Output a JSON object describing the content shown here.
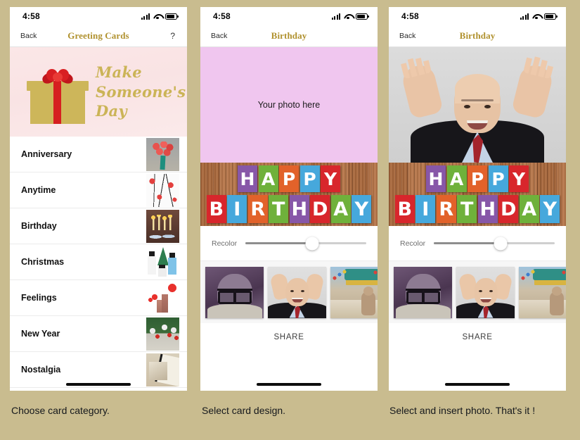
{
  "app": {
    "background_color": "#c9bc8f"
  },
  "status_bar": {
    "time": "4:58",
    "icons": [
      "signal-icon",
      "wifi-icon",
      "battery-icon"
    ]
  },
  "phones": [
    {
      "id": "phone-category-list",
      "nav": {
        "back": "Back",
        "title": "Greeting Cards",
        "help": "?"
      },
      "hero": {
        "headline": "Make\nSomeone's\nDay",
        "background_color": "#fbe7e7",
        "accent_color": "#cbb457",
        "icon": "gift-box-icon"
      },
      "categories": [
        {
          "label": "Anniversary",
          "thumb": "roses-thumbnail"
        },
        {
          "label": "Anytime",
          "thumb": "floral-thumbnail"
        },
        {
          "label": "Birthday",
          "thumb": "candles-thumbnail"
        },
        {
          "label": "Christmas",
          "thumb": "snowmen-thumbnail"
        },
        {
          "label": "Feelings",
          "thumb": "hearts-thumbnail"
        },
        {
          "label": "New Year",
          "thumb": "wreath-thumbnail"
        },
        {
          "label": "Nostalgia",
          "thumb": "old-photos-thumbnail"
        }
      ]
    },
    {
      "id": "phone-card-design",
      "nav": {
        "back": "Back",
        "title": "Birthday",
        "help": ""
      },
      "photo": {
        "placeholder": "Your photo here",
        "filled": false,
        "background_color": "#f0c6ef"
      },
      "slider": {
        "label": "Recolor",
        "value": 55
      },
      "photo_strip": [
        {
          "name": "purple-portrait-thumbnail"
        },
        {
          "name": "old-man-hands-thumbnail"
        },
        {
          "name": "monkey-temple-thumbnail"
        }
      ],
      "share_label": "SHARE"
    },
    {
      "id": "phone-photo-inserted",
      "nav": {
        "back": "Back",
        "title": "Birthday",
        "help": ""
      },
      "photo": {
        "placeholder": "",
        "filled": true,
        "background_color": "#d8d8d8"
      },
      "slider": {
        "label": "Recolor",
        "value": 55
      },
      "photo_strip": [
        {
          "name": "purple-portrait-thumbnail"
        },
        {
          "name": "old-man-hands-thumbnail"
        },
        {
          "name": "monkey-temple-thumbnail"
        }
      ],
      "share_label": "SHARE"
    }
  ],
  "card_letters": {
    "row1": [
      {
        "ch": "H",
        "color": "#8757a8"
      },
      {
        "ch": "A",
        "color": "#6fb13b"
      },
      {
        "ch": "P",
        "color": "#e2622a"
      },
      {
        "ch": "P",
        "color": "#46a8dc"
      },
      {
        "ch": "Y",
        "color": "#d8262c"
      }
    ],
    "row2": [
      {
        "ch": "B",
        "color": "#d8262c"
      },
      {
        "ch": "I",
        "color": "#46a8dc"
      },
      {
        "ch": "R",
        "color": "#e2622a"
      },
      {
        "ch": "T",
        "color": "#6fb13b"
      },
      {
        "ch": "H",
        "color": "#8757a8"
      },
      {
        "ch": "D",
        "color": "#d8262c"
      },
      {
        "ch": "A",
        "color": "#6fb13b"
      },
      {
        "ch": "Y",
        "color": "#46a8dc"
      }
    ]
  },
  "captions": [
    "Choose card category.",
    "Select card design.",
    "Select and insert photo. That's it !"
  ]
}
